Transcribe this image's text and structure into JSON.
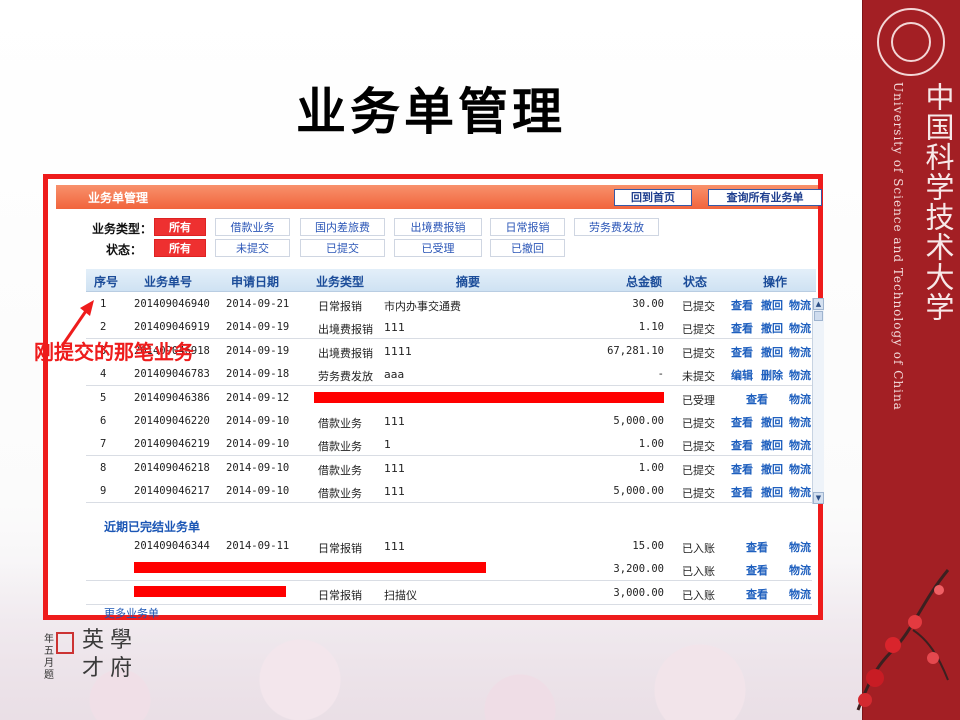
{
  "slide_title": "业务单管理",
  "annotation": "刚提交的那笔业务",
  "brand": {
    "name_cn": "中国科学技术大学",
    "name_en": "University of Science and Technology of China"
  },
  "calligraphy": {
    "line1": "英",
    "line2": "才",
    "line3": "學",
    "line4": "府",
    "small": "年五月题"
  },
  "panel": {
    "title": "业务单管理",
    "buttons": {
      "home": "回到首页",
      "all": "查询所有业务单"
    },
    "filters": {
      "type_label": "业务类型：",
      "types": [
        "所有",
        "借款业务",
        "国内差旅费",
        "出境费报销",
        "日常报销",
        "劳务费发放"
      ],
      "status_label": "状态：",
      "statuses": [
        "所有",
        "未提交",
        "已提交",
        "已受理",
        "已撤回"
      ]
    },
    "headers": [
      "序号",
      "业务单号",
      "申请日期",
      "业务类型",
      "摘要",
      "总金额",
      "状态",
      "操作"
    ],
    "rows": [
      {
        "no": "1",
        "id": "201409046940",
        "date": "2014-09-21",
        "type": "日常报销",
        "summary": "市内办事交通费",
        "amount": "30.00",
        "status": "已提交",
        "a1": "查看",
        "a2": "撤回",
        "a3": "物流"
      },
      {
        "no": "2",
        "id": "201409046919",
        "date": "2014-09-19",
        "type": "出境费报销",
        "summary": "111",
        "amount": "1.10",
        "status": "已提交",
        "a1": "查看",
        "a2": "撤回",
        "a3": "物流"
      },
      {
        "no": "3",
        "id": "201409046918",
        "date": "2014-09-19",
        "type": "出境费报销",
        "summary": "1111",
        "amount": "67,281.10",
        "status": "已提交",
        "a1": "查看",
        "a2": "撤回",
        "a3": "物流"
      },
      {
        "no": "4",
        "id": "201409046783",
        "date": "2014-09-18",
        "type": "劳务费发放",
        "summary": "aaa",
        "amount": "-",
        "status": "未提交",
        "a1": "编辑",
        "a2": "删除",
        "a3": "物流"
      },
      {
        "no": "5",
        "id": "201409046386",
        "date": "2014-09-12",
        "type": "",
        "summary": "",
        "amount": "",
        "status": "已受理",
        "a1": "查看",
        "a2": "",
        "a3": "物流"
      },
      {
        "no": "6",
        "id": "201409046220",
        "date": "2014-09-10",
        "type": "借款业务",
        "summary": "111",
        "amount": "5,000.00",
        "status": "已提交",
        "a1": "查看",
        "a2": "撤回",
        "a3": "物流"
      },
      {
        "no": "7",
        "id": "201409046219",
        "date": "2014-09-10",
        "type": "借款业务",
        "summary": "1",
        "amount": "1.00",
        "status": "已提交",
        "a1": "查看",
        "a2": "撤回",
        "a3": "物流"
      },
      {
        "no": "8",
        "id": "201409046218",
        "date": "2014-09-10",
        "type": "借款业务",
        "summary": "111",
        "amount": "1.00",
        "status": "已提交",
        "a1": "查看",
        "a2": "撤回",
        "a3": "物流"
      },
      {
        "no": "9",
        "id": "201409046217",
        "date": "2014-09-10",
        "type": "借款业务",
        "summary": "111",
        "amount": "5,000.00",
        "status": "已提交",
        "a1": "查看",
        "a2": "撤回",
        "a3": "物流"
      }
    ],
    "completed_title": "近期已完结业务单",
    "completed_rows": [
      {
        "id": "201409046344",
        "date": "2014-09-11",
        "type": "日常报销",
        "summary": "111",
        "amount": "15.00",
        "status": "已入账",
        "a1": "查看",
        "a3": "物流"
      },
      {
        "id": "",
        "date": "",
        "type": "",
        "summary": "",
        "amount": "3,200.00",
        "status": "已入账",
        "a1": "查看",
        "a3": "物流"
      },
      {
        "id": "",
        "date": "",
        "type": "日常报销",
        "summary": "扫描仪",
        "amount": "3,000.00",
        "status": "已入账",
        "a1": "查看",
        "a3": "物流"
      }
    ],
    "more_link": "更多业务单"
  },
  "colors": {
    "frame": "#ee1c1c",
    "header": "#f1643c",
    "link": "#1e5fbe",
    "brand": "#a31f24"
  }
}
